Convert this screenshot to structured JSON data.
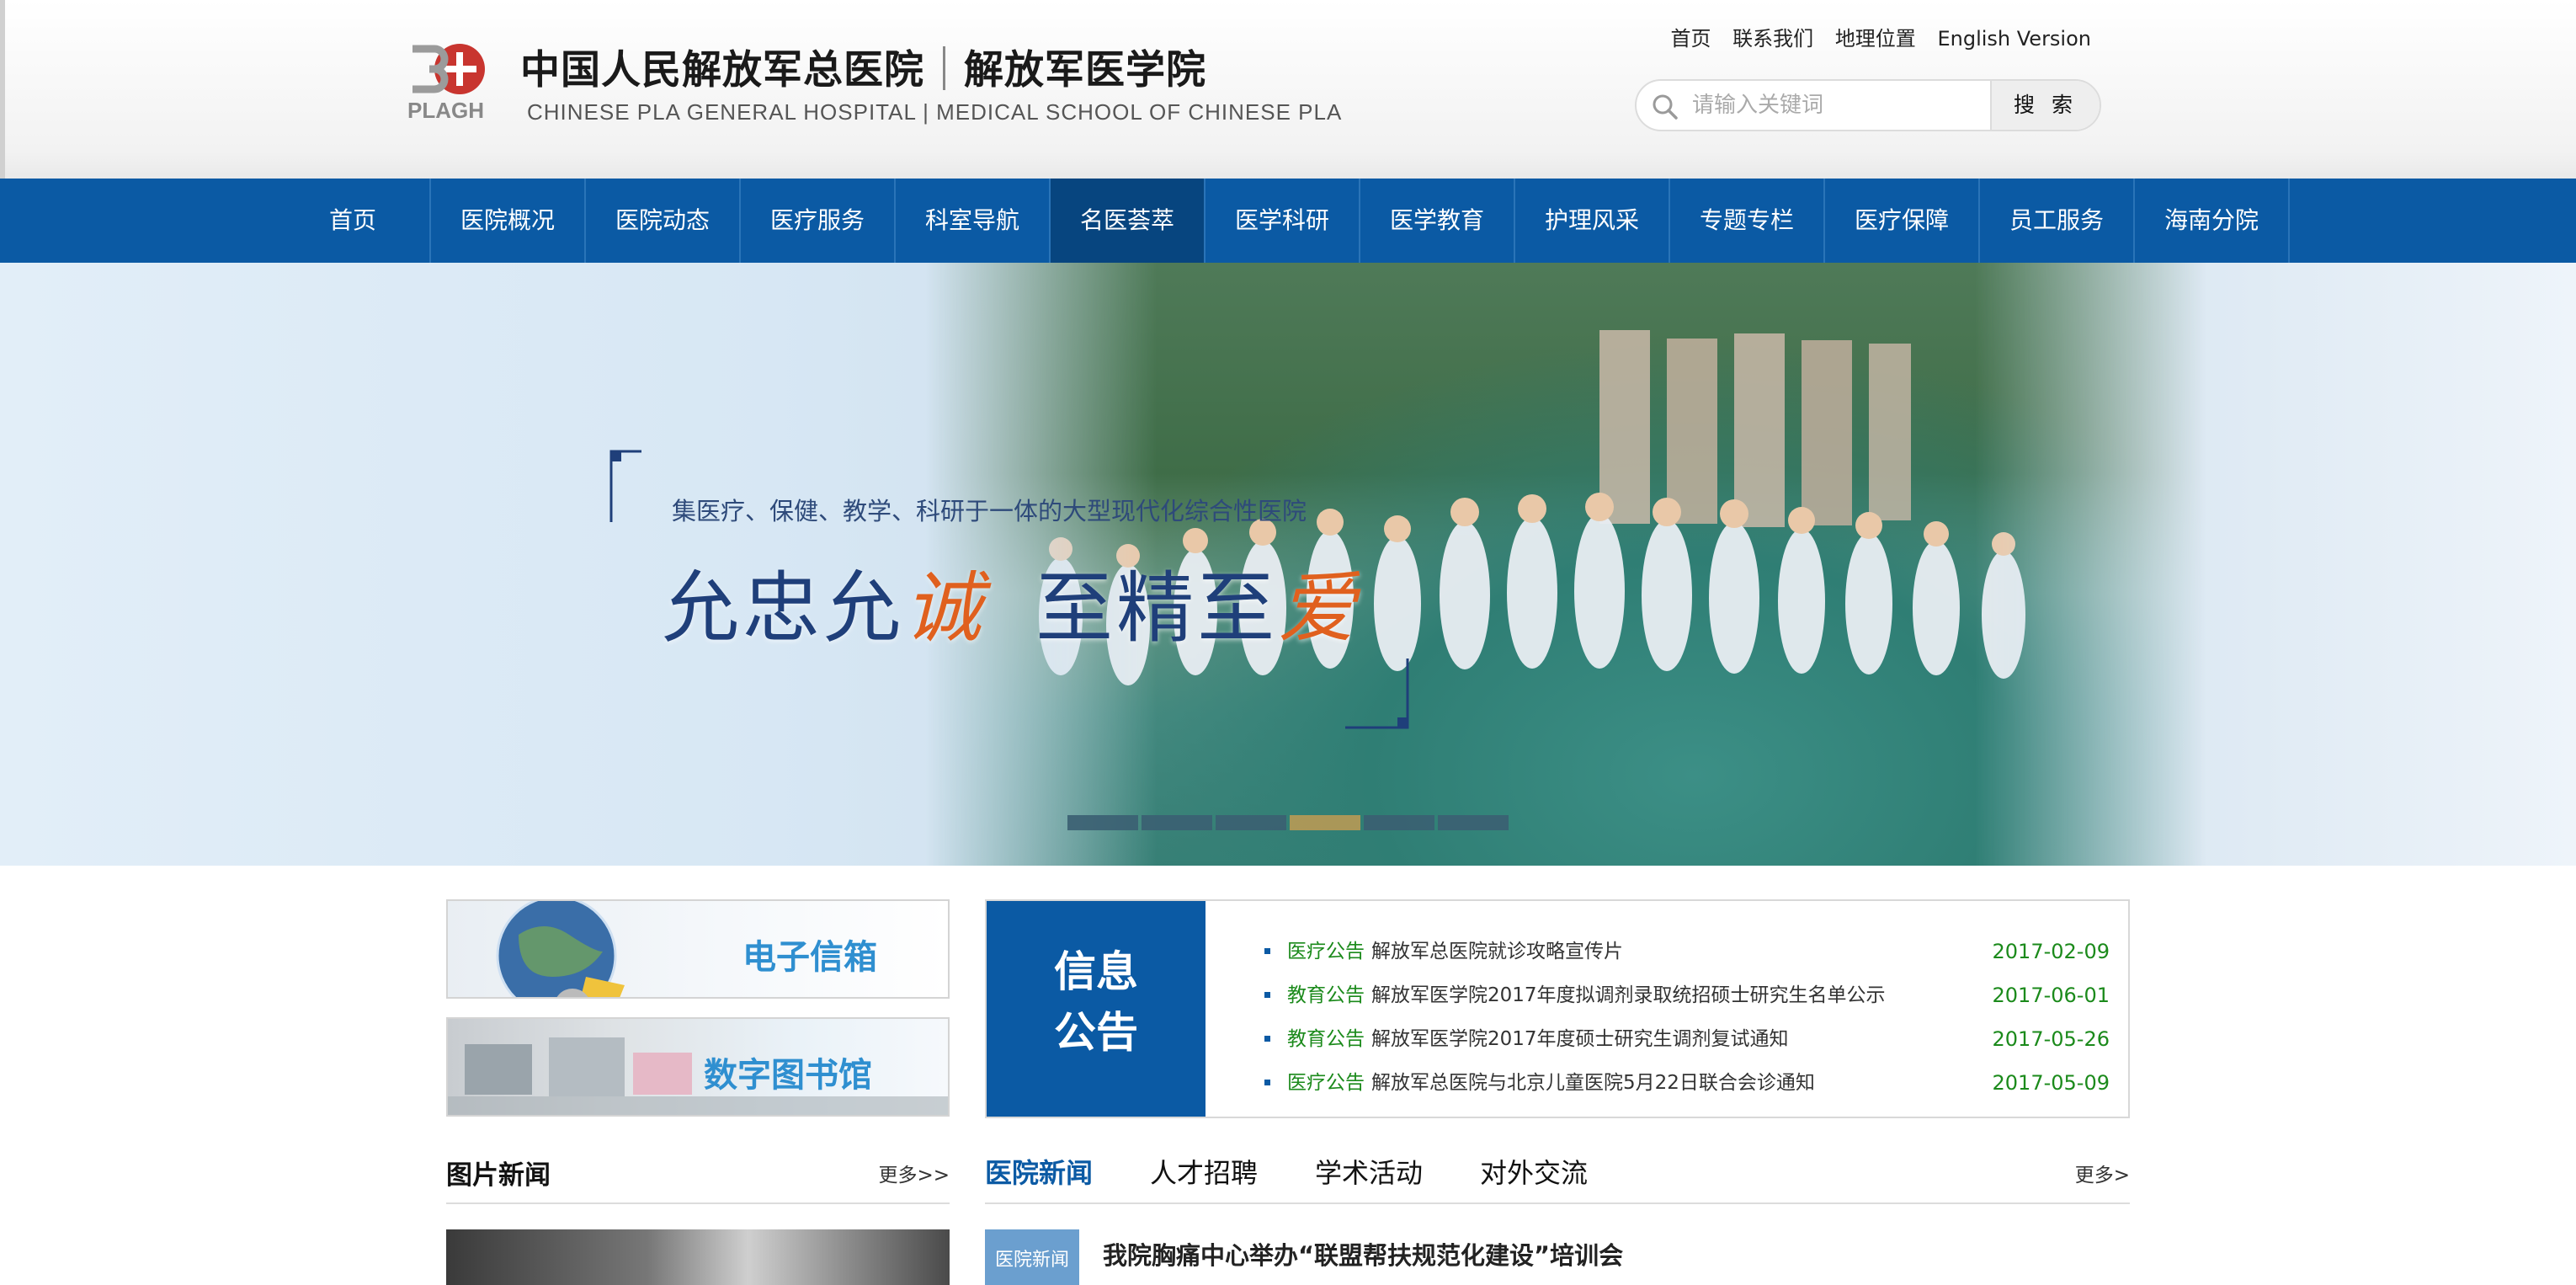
{
  "header": {
    "logo_number": "301",
    "logo_text": "PLAGH",
    "title_cn_1": "中国人民解放军总医院",
    "title_cn_2": "解放军医学院",
    "title_en": "CHINESE PLA GENERAL HOSPITAL  |  MEDICAL SCHOOL OF CHINESE PLA",
    "top_links": [
      "首页",
      "联系我们",
      "地理位置",
      "English Version"
    ],
    "search": {
      "placeholder": "请输入关键词",
      "value": "",
      "button": "搜 索"
    }
  },
  "nav": {
    "items": [
      "首页",
      "医院概况",
      "医院动态",
      "医疗服务",
      "科室导航",
      "名医荟萃",
      "医学科研",
      "医学教育",
      "护理风采",
      "专题专栏",
      "医疗保障",
      "员工服务",
      "海南分院"
    ],
    "active_index": 5
  },
  "banner": {
    "subtitle": "集医疗、保健、教学、科研于一体的大型现代化综合性医院",
    "slogan_1": "允",
    "slogan_2": "忠",
    "slogan_3": "允",
    "slogan_4": "诚",
    "slogan_5": "至",
    "slogan_6": "精",
    "slogan_7": "至",
    "slogan_8": "爱",
    "slides_total": 6,
    "active_slide": 4
  },
  "quick_links": {
    "email": "电子信箱",
    "library": "数字图书馆"
  },
  "notice": {
    "heading_1": "信息",
    "heading_2": "公告",
    "items": [
      {
        "tag": "医疗公告",
        "text": "解放军总医院就诊攻略宣传片",
        "date": "2017-02-09"
      },
      {
        "tag": "教育公告",
        "text": "解放军医学院2017年度拟调剂录取统招硕士研究生名单公示",
        "date": "2017-06-01"
      },
      {
        "tag": "教育公告",
        "text": "解放军医学院2017年度硕士研究生调剂复试通知",
        "date": "2017-05-26"
      },
      {
        "tag": "医疗公告",
        "text": "解放军总医院与北京儿童医院5月22日联合会诊通知",
        "date": "2017-05-09"
      }
    ]
  },
  "photo_news": {
    "title": "图片新闻",
    "more": "更多>>"
  },
  "news_tabs": {
    "tabs": [
      "医院新闻",
      "人才招聘",
      "学术活动",
      "对外交流"
    ],
    "active_index": 0,
    "more": "更多>",
    "first_item": {
      "tag": "医院新闻",
      "title": "我院胸痛中心举办“联盟帮扶规范化建设”培训会"
    }
  },
  "colors": {
    "brand_blue": "#0b5aa4",
    "nav_active": "#07457f",
    "accent_orange": "#e0601e",
    "notice_green": "#1b8a1b"
  }
}
